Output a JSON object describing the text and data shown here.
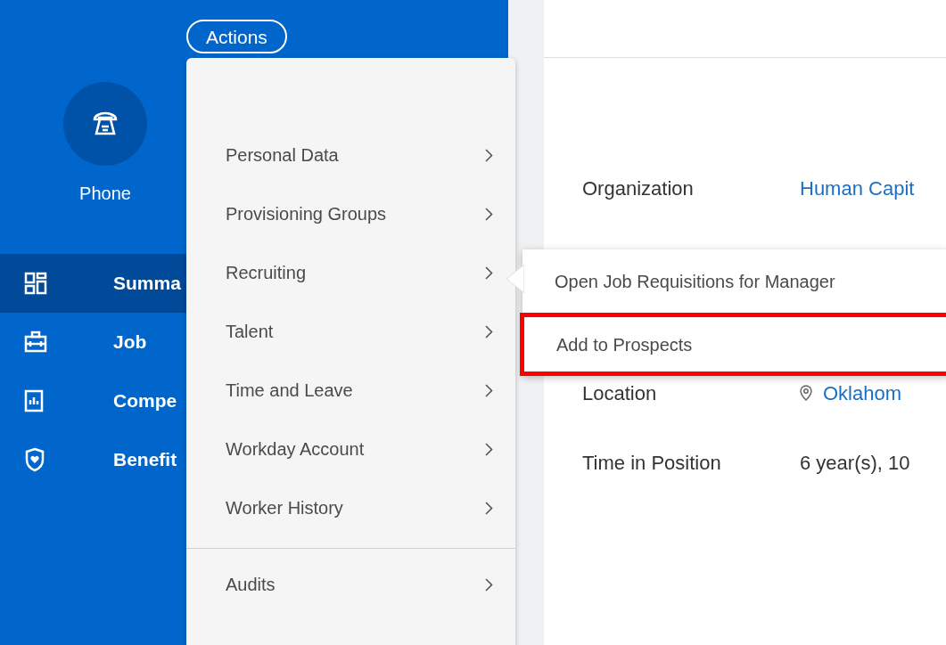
{
  "header": {
    "actions_button": "Actions"
  },
  "contact": {
    "label": "Phone"
  },
  "nav": [
    {
      "label": "Summa",
      "kind": "summary",
      "selected": true
    },
    {
      "label": "Job",
      "kind": "job",
      "selected": false
    },
    {
      "label": "Compe",
      "kind": "compensation",
      "selected": false
    },
    {
      "label": "Benefit",
      "kind": "benefits",
      "selected": false
    }
  ],
  "fields": [
    {
      "label": "Organization",
      "value": "Human Capit",
      "kind": "link"
    },
    {
      "label": "Location",
      "value": "Oklahom",
      "kind": "location"
    },
    {
      "label": "Time in Position",
      "value": "6 year(s), 10",
      "kind": "text"
    }
  ],
  "actions_menu": {
    "groups": [
      [
        {
          "label": "Personal Data"
        },
        {
          "label": "Provisioning Groups"
        },
        {
          "label": "Recruiting"
        },
        {
          "label": "Talent"
        },
        {
          "label": "Time and Leave"
        },
        {
          "label": "Workday Account"
        },
        {
          "label": "Worker History"
        }
      ],
      [
        {
          "label": "Audits"
        }
      ]
    ]
  },
  "submenu": {
    "items": [
      {
        "label": "Open Job Requisitions for Manager",
        "highlighted": false
      },
      {
        "label": "Add to Prospects",
        "highlighted": true
      }
    ]
  }
}
